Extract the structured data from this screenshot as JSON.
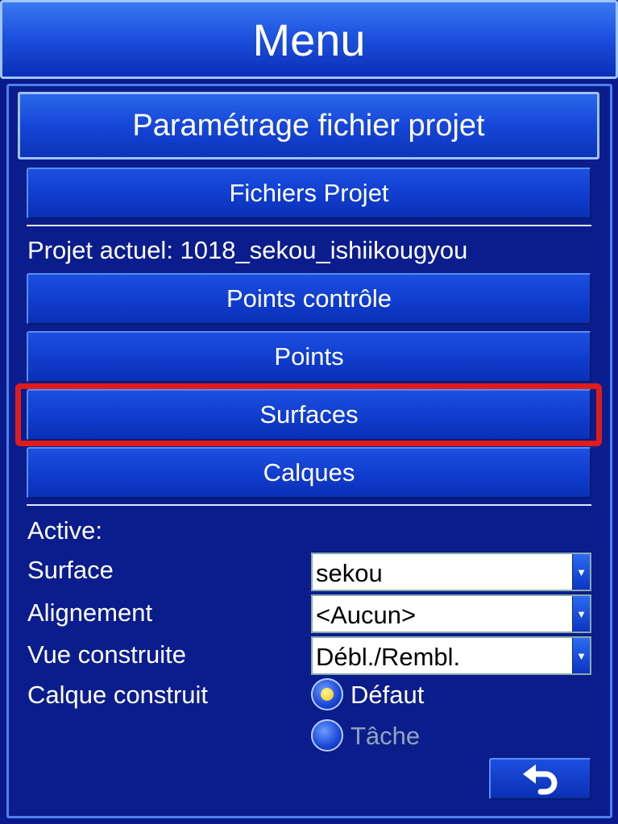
{
  "window": {
    "title": "Menu"
  },
  "section": {
    "title": "Paramétrage fichier projet"
  },
  "buttons": {
    "project_files": "Fichiers Projet",
    "control_points": "Points contrôle",
    "points": "Points",
    "surfaces": "Surfaces",
    "layers": "Calques"
  },
  "project": {
    "current": "Projet actuel: 1018_sekou_ishiikougyou"
  },
  "active": {
    "heading": "Active:",
    "surface_label": "Surface",
    "surface_value": "sekou",
    "alignment_label": "Alignement",
    "alignment_value": "<Aucun>",
    "view_label": "Vue construite",
    "view_value": "Débl./Rembl.",
    "layer_label": "Calque construit",
    "layer_options": [
      {
        "label": "Défaut",
        "selected": true,
        "enabled": true
      },
      {
        "label": "Tâche",
        "selected": false,
        "enabled": false
      }
    ]
  },
  "icons": {
    "back": "undo-arrow-icon",
    "dropdown": "dropdown-arrow-icon"
  },
  "colors": {
    "highlight": "#e11b1b",
    "background": "#0b1d8c",
    "accent": "#1d52e0"
  }
}
